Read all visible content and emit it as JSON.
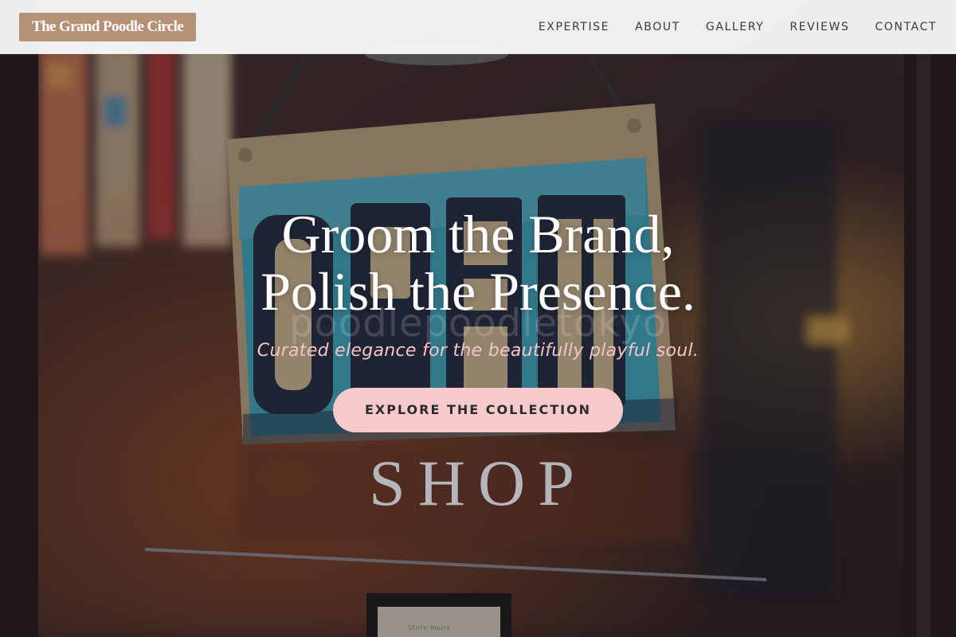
{
  "brand": {
    "name": "The Grand Poodle Circle",
    "logo_color": "#b79176"
  },
  "nav": {
    "items": [
      {
        "label": "EXPERTISE"
      },
      {
        "label": "ABOUT"
      },
      {
        "label": "GALLERY"
      },
      {
        "label": "REVIEWS"
      },
      {
        "label": "CONTACT"
      }
    ]
  },
  "hero": {
    "headline_line1": "Groom the Brand,",
    "headline_line2": "Polish the Presence.",
    "ghost_text": "poodlepoodletokyo",
    "tagline": "Curated elegance for the beautifully playful soul.",
    "cta_label": "EXPLORE THE COLLECTION",
    "cta_color": "#f6caca",
    "tagline_color": "#f3c4c7"
  },
  "background": {
    "sign_text": "OPEN",
    "door_lettering": "SHOP",
    "receipt_text": "Store Hours"
  }
}
